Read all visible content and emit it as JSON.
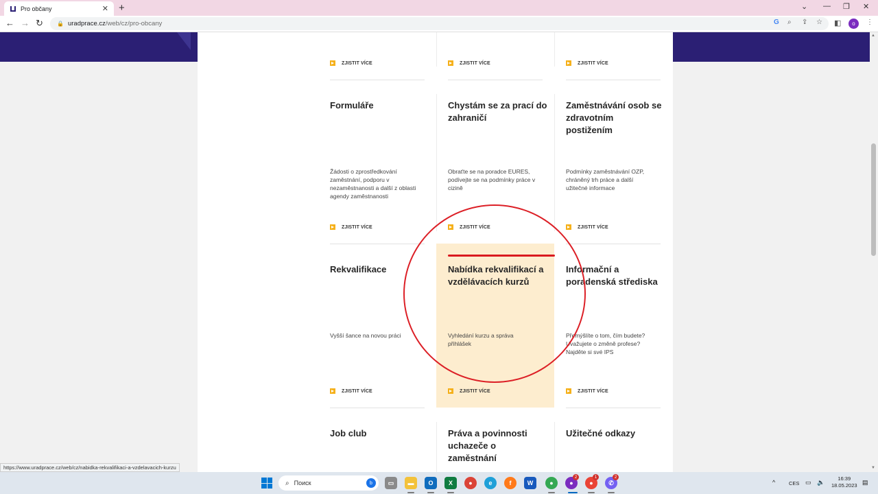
{
  "browser": {
    "tab_title": "Pro občany",
    "new_tab": "+",
    "close_tab": "✕",
    "url_domain": "uradprace.cz",
    "url_path": "/web/cz/pro-obcany",
    "profile_initial": "o",
    "status_url": "https://www.uradprace.cz/web/cz/nabidka-rekvalifikaci-a-vzdelavacich-kurzu"
  },
  "more_label": "ZJISTIT VÍCE",
  "cards": [
    {
      "title": "Formuláře",
      "desc": "Žádosti o zprostředkování zaměstnání, podporu v nezaměstnanosti a další z oblasti agendy zaměstnanosti",
      "more": "ZJISTIT VÍCE"
    },
    {
      "title": "Chystám se za prací do zahraničí",
      "desc": "Obraťte se na poradce EURES, podívejte se na podmínky práce v cizině",
      "more": "ZJISTIT VÍCE"
    },
    {
      "title": "Zaměstnávání osob se zdravotním postižením",
      "desc": "Podmínky zaměstnávání OZP, chráněný trh práce a další užitečné informace",
      "more": "ZJISTIT VÍCE"
    },
    {
      "title": "Rekvalifikace",
      "desc": "Vyšší šance na novou práci",
      "more": "ZJISTIT VÍCE"
    },
    {
      "title": "Nabídka rekvalifikací a vzdělávacích kurzů",
      "desc": "Vyhledání kurzu a správa přihlášek",
      "more": "ZJISTIT VÍCE"
    },
    {
      "title": "Informační a poradenská střediska",
      "desc": "Přemýšlíte o tom, čím budete? Uvažujete o změně profese? Najděte si své IPS",
      "more": "ZJISTIT VÍCE"
    },
    {
      "title": "Job club"
    },
    {
      "title": "Práva a povinnosti uchazeče o zaměstnání"
    },
    {
      "title": "Užitečné odkazy"
    }
  ],
  "taskbar": {
    "search_placeholder": "Поиск",
    "lang": "CES",
    "time": "16:39",
    "date": "18.05.2023",
    "badges": [
      "2",
      "1",
      "2"
    ]
  }
}
